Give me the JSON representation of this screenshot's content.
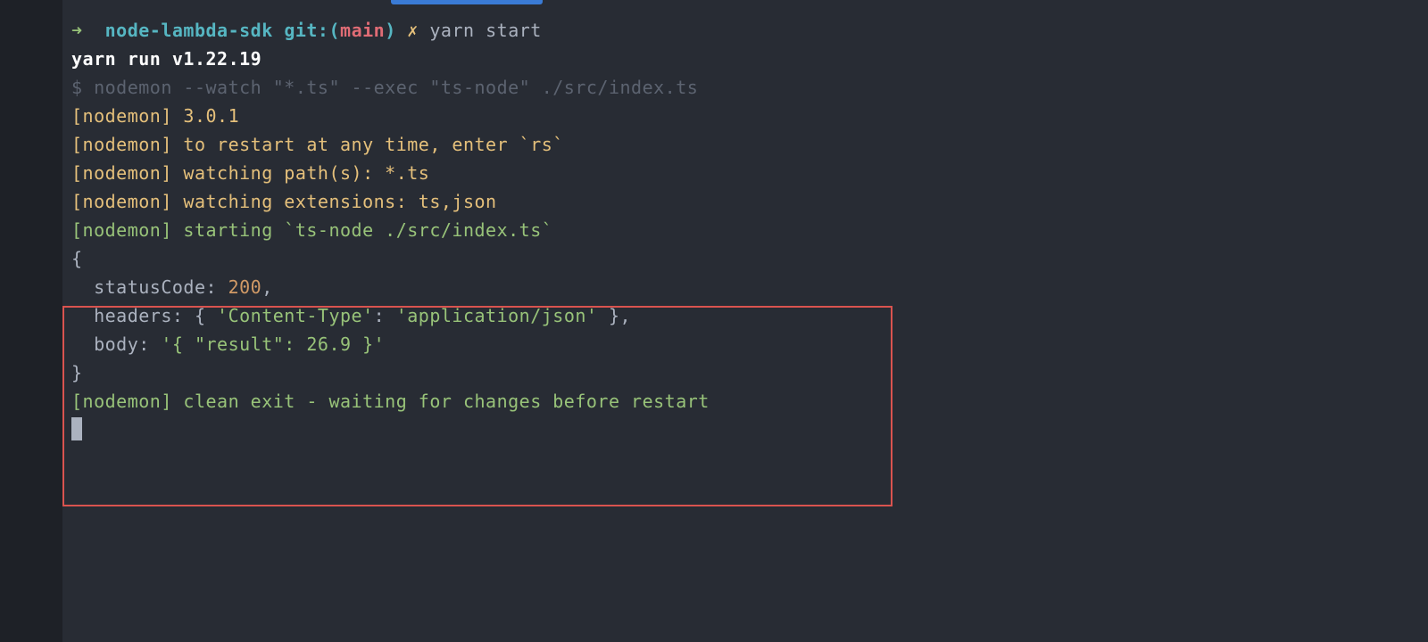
{
  "prompt": {
    "arrow": "➜",
    "dir": "node-lambda-sdk",
    "gitlabel": "git:",
    "paren_open": "(",
    "branch": "main",
    "paren_close": ")",
    "x": "✗",
    "cmd": "yarn",
    "arg": "start"
  },
  "yarn_line": "yarn run v1.22.19",
  "exec_line": {
    "dollar": "$",
    "rest": " nodemon --watch \"*.ts\" --exec \"ts-node\" ./src/index.ts"
  },
  "nodemon": {
    "l1_tag": "[nodemon]",
    "l1_msg": " 3.0.1",
    "l2_tag": "[nodemon]",
    "l2_msg": " to restart at any time, enter `rs`",
    "l3_tag": "[nodemon]",
    "l3_msg": " watching path(s): *.ts",
    "l4_tag": "[nodemon]",
    "l4_msg": " watching extensions: ts,json",
    "l5_tag": "[nodemon]",
    "l5_msg": " starting `ts-node ./src/index.ts`"
  },
  "output": {
    "open": "{",
    "status_key": "  statusCode: ",
    "status_val": "200",
    "status_comma": ",",
    "headers_key": "  headers: { ",
    "headers_ct_key": "'Content-Type'",
    "headers_colon": ": ",
    "headers_ct_val": "'application/json'",
    "headers_close": " },",
    "body_key": "  body: ",
    "body_val": "'{ \"result\": 26.9 }'",
    "close": "}"
  },
  "final": {
    "tag": "[nodemon]",
    "msg": " clean exit - waiting for changes before restart"
  }
}
